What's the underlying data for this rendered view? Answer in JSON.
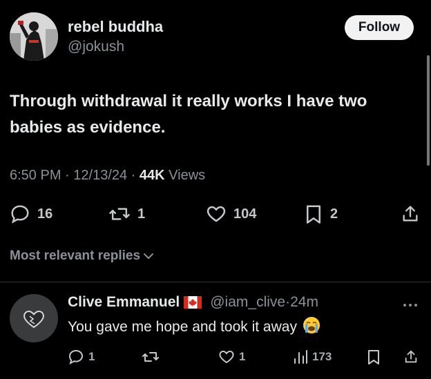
{
  "post": {
    "author_name": "rebel buddha",
    "author_handle": "@jokush",
    "follow_label": "Follow",
    "text_line1": "Through withdrawal it really works I have two",
    "text_line2": "babies as evidence.",
    "time": "6:50 PM",
    "sep1": " · ",
    "date": "12/13/24",
    "sep2": " · ",
    "views_count": "44K",
    "views_label": " Views",
    "replies_count": "16",
    "reposts_count": "1",
    "likes_count": "104",
    "bookmarks_count": "2"
  },
  "replies_section": {
    "sort_label": "Most relevant replies"
  },
  "reply": {
    "name": "Clive Emmanuel",
    "flag_icon": "canada-flag-icon",
    "handle": "@iam_clive",
    "sep": " · ",
    "time": "24m",
    "text": "You gave me hope and took it away",
    "emoji_icon": "crying-face-icon",
    "replies_count": "1",
    "likes_count": "1",
    "views_count": "173"
  },
  "colors": {
    "background": "#000000",
    "primary_text": "#e7e9ea",
    "secondary_text": "#8b9198",
    "follow_bg": "#f2f2f2",
    "divider": "#2f3336"
  }
}
